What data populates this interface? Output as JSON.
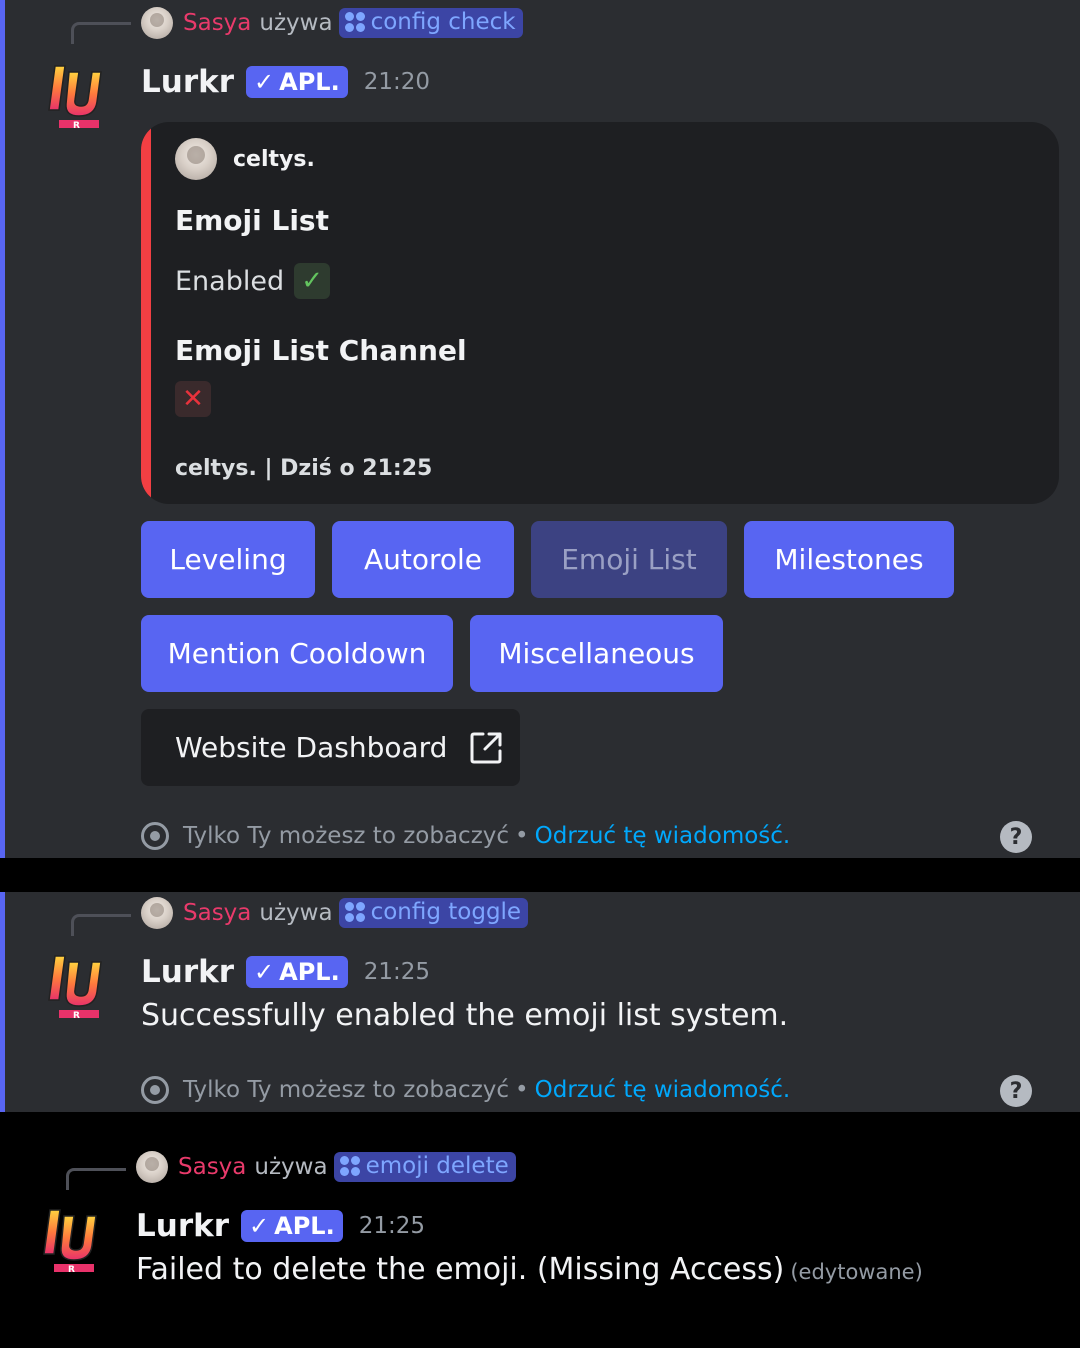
{
  "messages": [
    {
      "reply": {
        "user": "Sasya",
        "uses": "używa",
        "command": "config check"
      },
      "bot": {
        "name": "Lurkr",
        "badge": "APL.",
        "time": "21:20"
      },
      "embed": {
        "author": "celtys.",
        "fields": [
          {
            "name": "Emoji List",
            "value": "Enabled",
            "emoji": "check-mark"
          },
          {
            "name": "Emoji List Channel",
            "value": "",
            "emoji": "cross-mark"
          }
        ],
        "footer": "celtys. | Dziś o 21:25",
        "accent": "#f23f43"
      },
      "buttons": [
        "Leveling",
        "Autorole",
        "Emoji List",
        "Milestones",
        "Mention Cooldown",
        "Miscellaneous"
      ],
      "disabled_button": "Emoji List",
      "link_button": "Website Dashboard",
      "ephemeral": {
        "note": "Tylko Ty możesz to zobaczyć",
        "sep": "•",
        "dismiss": "Odrzuć tę wiadomość."
      }
    },
    {
      "reply": {
        "user": "Sasya",
        "uses": "używa",
        "command": "config toggle"
      },
      "bot": {
        "name": "Lurkr",
        "badge": "APL.",
        "time": "21:25"
      },
      "text": "Successfully enabled the emoji list system.",
      "ephemeral": {
        "note": "Tylko Ty możesz to zobaczyć",
        "sep": "•",
        "dismiss": "Odrzuć tę wiadomość."
      }
    },
    {
      "reply": {
        "user": "Sasya",
        "uses": "używa",
        "command": "emoji delete"
      },
      "bot": {
        "name": "Lurkr",
        "badge": "APL.",
        "time": "21:25"
      },
      "text": "Failed to delete the emoji. (Missing Access)",
      "edited": "(edytowane)"
    }
  ],
  "colors": {
    "blurple": "#5865f2",
    "link": "#00a8fc",
    "mention_name": "#e93a6b"
  }
}
